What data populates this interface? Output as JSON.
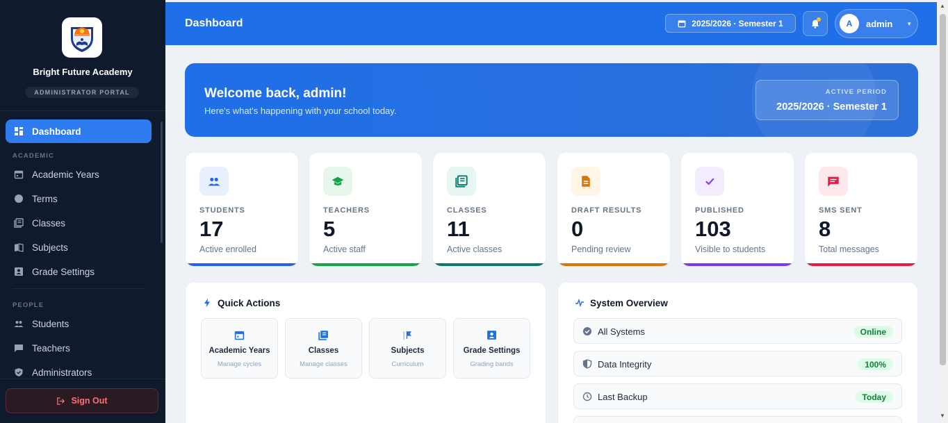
{
  "sidebar": {
    "school_name": "Bright Future Academy",
    "portal_label": "ADMINISTRATOR PORTAL",
    "dashboard_label": "Dashboard",
    "section_academic": "ACADEMIC",
    "academic_items": [
      {
        "label": "Academic Years",
        "icon": "calendar-icon"
      },
      {
        "label": "Terms",
        "icon": "circle-icon"
      },
      {
        "label": "Classes",
        "icon": "class-icon"
      },
      {
        "label": "Subjects",
        "icon": "book-icon"
      },
      {
        "label": "Grade Settings",
        "icon": "grade-icon"
      }
    ],
    "section_people": "PEOPLE",
    "people_items": [
      {
        "label": "Students",
        "icon": "people-icon"
      },
      {
        "label": "Teachers",
        "icon": "chalkboard-icon"
      },
      {
        "label": "Administrators",
        "icon": "shield-icon"
      }
    ],
    "signout_label": "Sign Out"
  },
  "header": {
    "title": "Dashboard",
    "period_button": "2025/2026 · Semester 1",
    "user_initial": "A",
    "user_name": "admin"
  },
  "welcome": {
    "title": "Welcome back, admin!",
    "subtitle": "Here's what's happening with your school today.",
    "period_label": "ACTIVE PERIOD",
    "period_value": "2025/2026 · Semester 1"
  },
  "stats": [
    {
      "label": "STUDENTS",
      "value": "17",
      "sub": "Active enrolled",
      "color": "#2563eb",
      "icon": "people-icon"
    },
    {
      "label": "TEACHERS",
      "value": "5",
      "sub": "Active staff",
      "color": "#16a34a",
      "icon": "graduation-cap-icon"
    },
    {
      "label": "CLASSES",
      "value": "11",
      "sub": "Active classes",
      "color": "#0f766e",
      "icon": "class-icon"
    },
    {
      "label": "DRAFT RESULTS",
      "value": "0",
      "sub": "Pending review",
      "color": "#d97706",
      "icon": "document-icon"
    },
    {
      "label": "PUBLISHED",
      "value": "103",
      "sub": "Visible to students",
      "color": "#7c3aed",
      "icon": "check-icon"
    },
    {
      "label": "SMS SENT",
      "value": "8",
      "sub": "Total messages",
      "color": "#e11d48",
      "icon": "message-icon"
    }
  ],
  "quick_actions": {
    "title": "Quick Actions",
    "items": [
      {
        "title": "Academic Years",
        "sub": "Manage cycles",
        "icon": "calendar-icon"
      },
      {
        "title": "Classes",
        "sub": "Manage classes",
        "icon": "class-icon"
      },
      {
        "title": "Subjects",
        "sub": "Curriculum",
        "icon": "flag-icon"
      },
      {
        "title": "Grade Settings",
        "sub": "Grading bands",
        "icon": "grade-icon"
      }
    ]
  },
  "system_overview": {
    "title": "System Overview",
    "rows": [
      {
        "label": "All Systems",
        "status": "Online",
        "icon": "check-circle-icon"
      },
      {
        "label": "Data Integrity",
        "status": "100%",
        "icon": "shield-icon"
      },
      {
        "label": "Last Backup",
        "status": "Today",
        "icon": "clock-icon"
      }
    ]
  },
  "colors": {
    "primary": "#1f6fe8",
    "sidebar_bg": "#0f1a2c",
    "signout": "#f87171",
    "success_badge": "#15803d"
  }
}
